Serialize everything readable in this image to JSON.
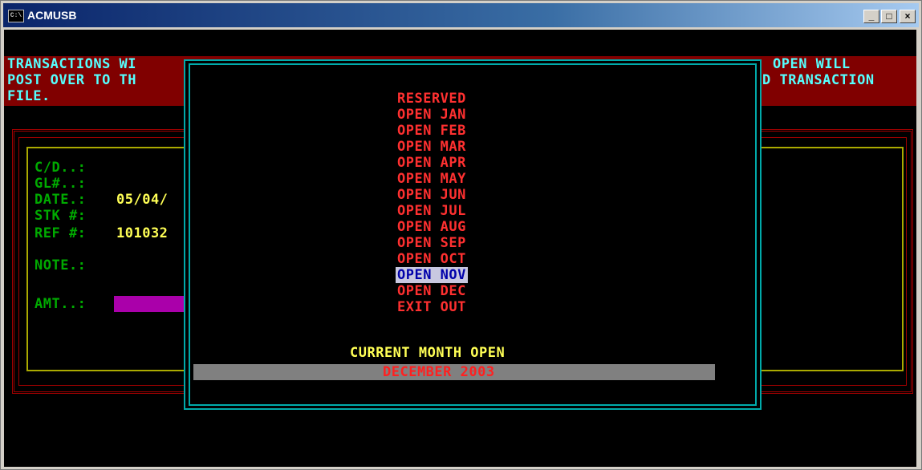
{
  "window": {
    "icon_text": "C:\\",
    "title": "ACMUSB",
    "minimize": "_",
    "maximize": "□",
    "close": "×"
  },
  "banner": {
    "line1_left": "TRANSACTIONS WI",
    "line2_left": "POST OVER TO TH",
    "line3_left": "FILE.",
    "line1_right": "OPEN WILL",
    "line2_right": "D TRANSACTION"
  },
  "form": {
    "cd_label": "C/D..:",
    "gl_label": "GL#..:",
    "date_label": "DATE.:",
    "date_value": "05/04/",
    "stk_label": "STK #:",
    "ref_label": "REF #:",
    "ref_value": "101032",
    "note_label": "NOTE.:",
    "amt_label": "AMT..:"
  },
  "menu": {
    "items": [
      "RESERVED",
      "OPEN JAN",
      "OPEN FEB",
      "OPEN MAR",
      "OPEN APR",
      "OPEN MAY",
      "OPEN JUN",
      "OPEN JUL",
      "OPEN AUG",
      "OPEN SEP",
      "OPEN OCT",
      "OPEN NOV",
      "OPEN DEC",
      "EXIT OUT"
    ],
    "selected": "OPEN NOV"
  },
  "current": {
    "label": "CURRENT MONTH OPEN",
    "value": "DECEMBER 2003"
  },
  "colors": {
    "console_bg": "#000000",
    "banner_bg": "#800000",
    "banner_text": "#55ffff",
    "menu_text": "#ff3030",
    "highlight_bg": "#c8c8e0",
    "label_green": "#00aa00",
    "value_yellow": "#ffff55",
    "popup_border": "#00aaaa"
  }
}
